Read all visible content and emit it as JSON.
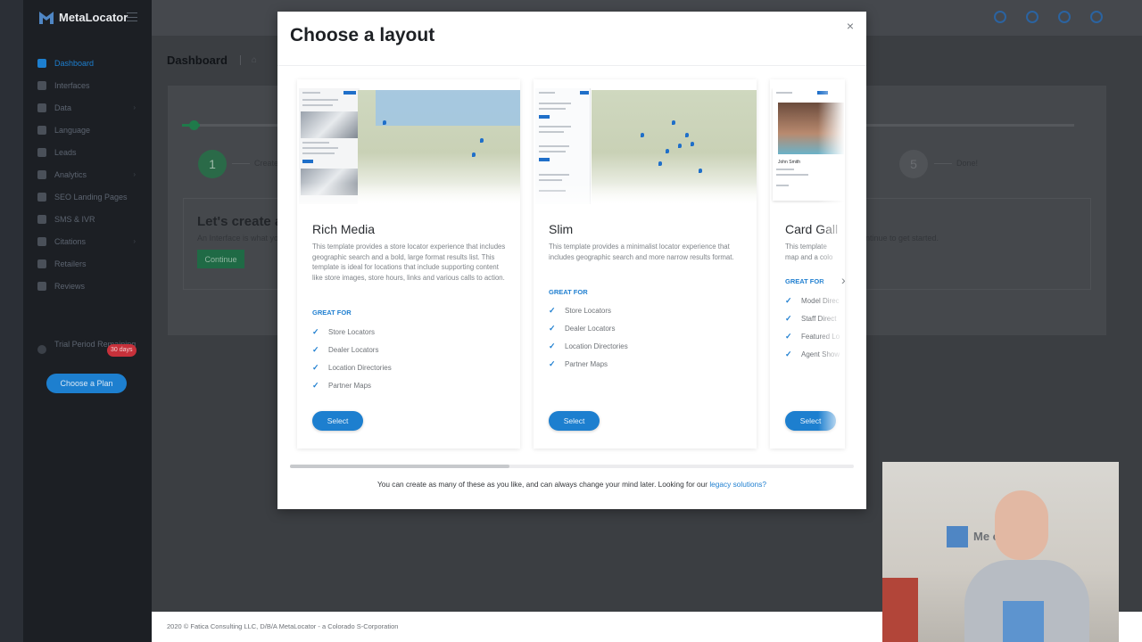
{
  "app": {
    "name": "MetaLocator"
  },
  "sidebar": {
    "items": [
      {
        "label": "Dashboard",
        "icon": "home-icon",
        "active": true,
        "has_submenu": false
      },
      {
        "label": "Interfaces",
        "icon": "monitor-icon",
        "active": false,
        "has_submenu": false
      },
      {
        "label": "Data",
        "icon": "database-icon",
        "active": false,
        "has_submenu": true
      },
      {
        "label": "Language",
        "icon": "globe-icon",
        "active": false,
        "has_submenu": false
      },
      {
        "label": "Leads",
        "icon": "inbox-icon",
        "active": false,
        "has_submenu": false
      },
      {
        "label": "Analytics",
        "icon": "chart-icon",
        "active": false,
        "has_submenu": true
      },
      {
        "label": "SEO Landing Pages",
        "icon": "search-icon",
        "active": false,
        "has_submenu": false
      },
      {
        "label": "SMS & IVR",
        "icon": "phone-icon",
        "active": false,
        "has_submenu": false
      },
      {
        "label": "Citations",
        "icon": "settings-icon",
        "active": false,
        "has_submenu": true
      },
      {
        "label": "Retailers",
        "icon": "store-icon",
        "active": false,
        "has_submenu": false
      },
      {
        "label": "Reviews",
        "icon": "star-icon",
        "active": false,
        "has_submenu": false
      }
    ],
    "trial_label": "Trial Period Remaining",
    "trial_badge": "30 days",
    "plan_button": "Choose a Plan"
  },
  "header": {
    "page_title": "Dashboard"
  },
  "wizard": {
    "step1_number": "1",
    "step1_label": "Create",
    "step5_number": "5",
    "step5_label": "Done!",
    "intro_title": "Let's create a",
    "intro_text": "An Interface is what yo",
    "intro_text_right": "ntinue to get started.",
    "continue_button": "Continue"
  },
  "footer": {
    "text": "2020 © Fatica Consulting LLC, D/B/A MetaLocator - a Colorado S-Corporation"
  },
  "modal": {
    "title": "Choose a layout",
    "close": "×",
    "great_for_label": "GREAT FOR",
    "select_label": "Select",
    "cards": [
      {
        "title": "Rich Media",
        "description": "This template provides a store locator experience that includes geographic search and a bold, large format results list. This template is ideal for locations that include supporting content like store images, store hours, links and various calls to action.",
        "features": [
          "Store Locators",
          "Dealer Locators",
          "Location Directories",
          "Partner Maps"
        ]
      },
      {
        "title": "Slim",
        "description": "This template provides a minimalist locator experience that includes geographic search and more narrow results format.",
        "features": [
          "Store Locators",
          "Dealer Locators",
          "Location Directories",
          "Partner Maps"
        ]
      },
      {
        "title": "Card Gall",
        "description": "This template\nmap and a colo",
        "features": [
          "Model Direc",
          "Staff Direct",
          "Featured Lo",
          "Agent Show"
        ],
        "thumb_name": "John Smith"
      }
    ],
    "footer_text": "You can create as many of these as you like, and can always change your mind later. Looking for our ",
    "footer_link": "legacy solutions?"
  },
  "webcam": {
    "wall_text": "Me          or"
  },
  "colors": {
    "accent": "#1d7fcf",
    "sidebar_bg": "#1c1f24",
    "success": "#2a6a48",
    "danger": "#c7313b"
  }
}
